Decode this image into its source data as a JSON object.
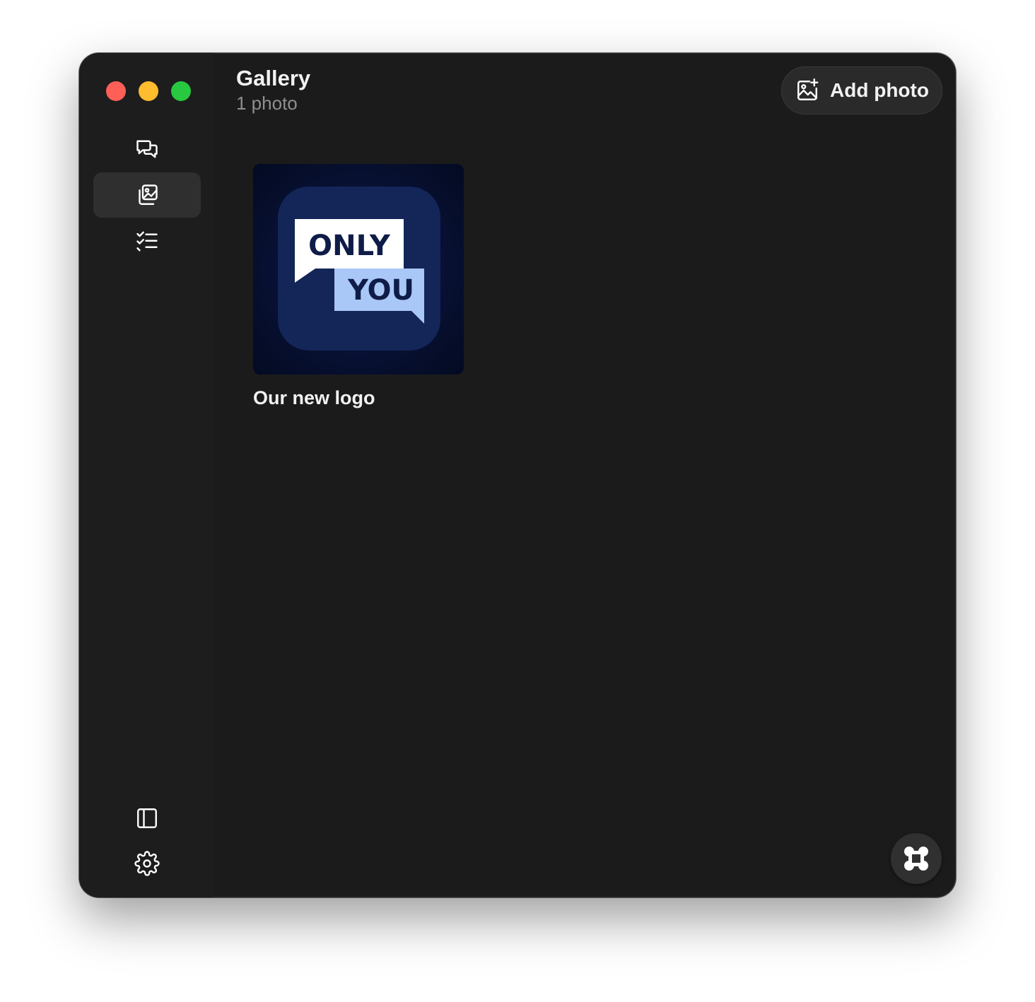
{
  "header": {
    "title": "Gallery",
    "subtitle": "1 photo",
    "add_button_label": "Add photo"
  },
  "sidebar": {
    "items": [
      {
        "icon": "chat-bubbles-icon",
        "active": false
      },
      {
        "icon": "photo-gallery-icon",
        "active": true
      },
      {
        "icon": "checklist-icon",
        "active": false
      }
    ],
    "bottom_items": [
      {
        "icon": "sidebar-toggle-icon"
      },
      {
        "icon": "gear-icon"
      }
    ]
  },
  "gallery": {
    "photos": [
      {
        "caption": "Our new logo",
        "logo_text_top": "ONLY",
        "logo_text_bottom": "YOU"
      }
    ]
  },
  "colors": {
    "window_bg": "#1b1b1b",
    "sidebar_active": "#2f2f2f",
    "traffic_close": "#fe5f57",
    "traffic_minimize": "#febc2e",
    "traffic_maximize": "#28c840",
    "logo_bg": "#0d1b45",
    "logo_accent": "#a9c7f7"
  }
}
